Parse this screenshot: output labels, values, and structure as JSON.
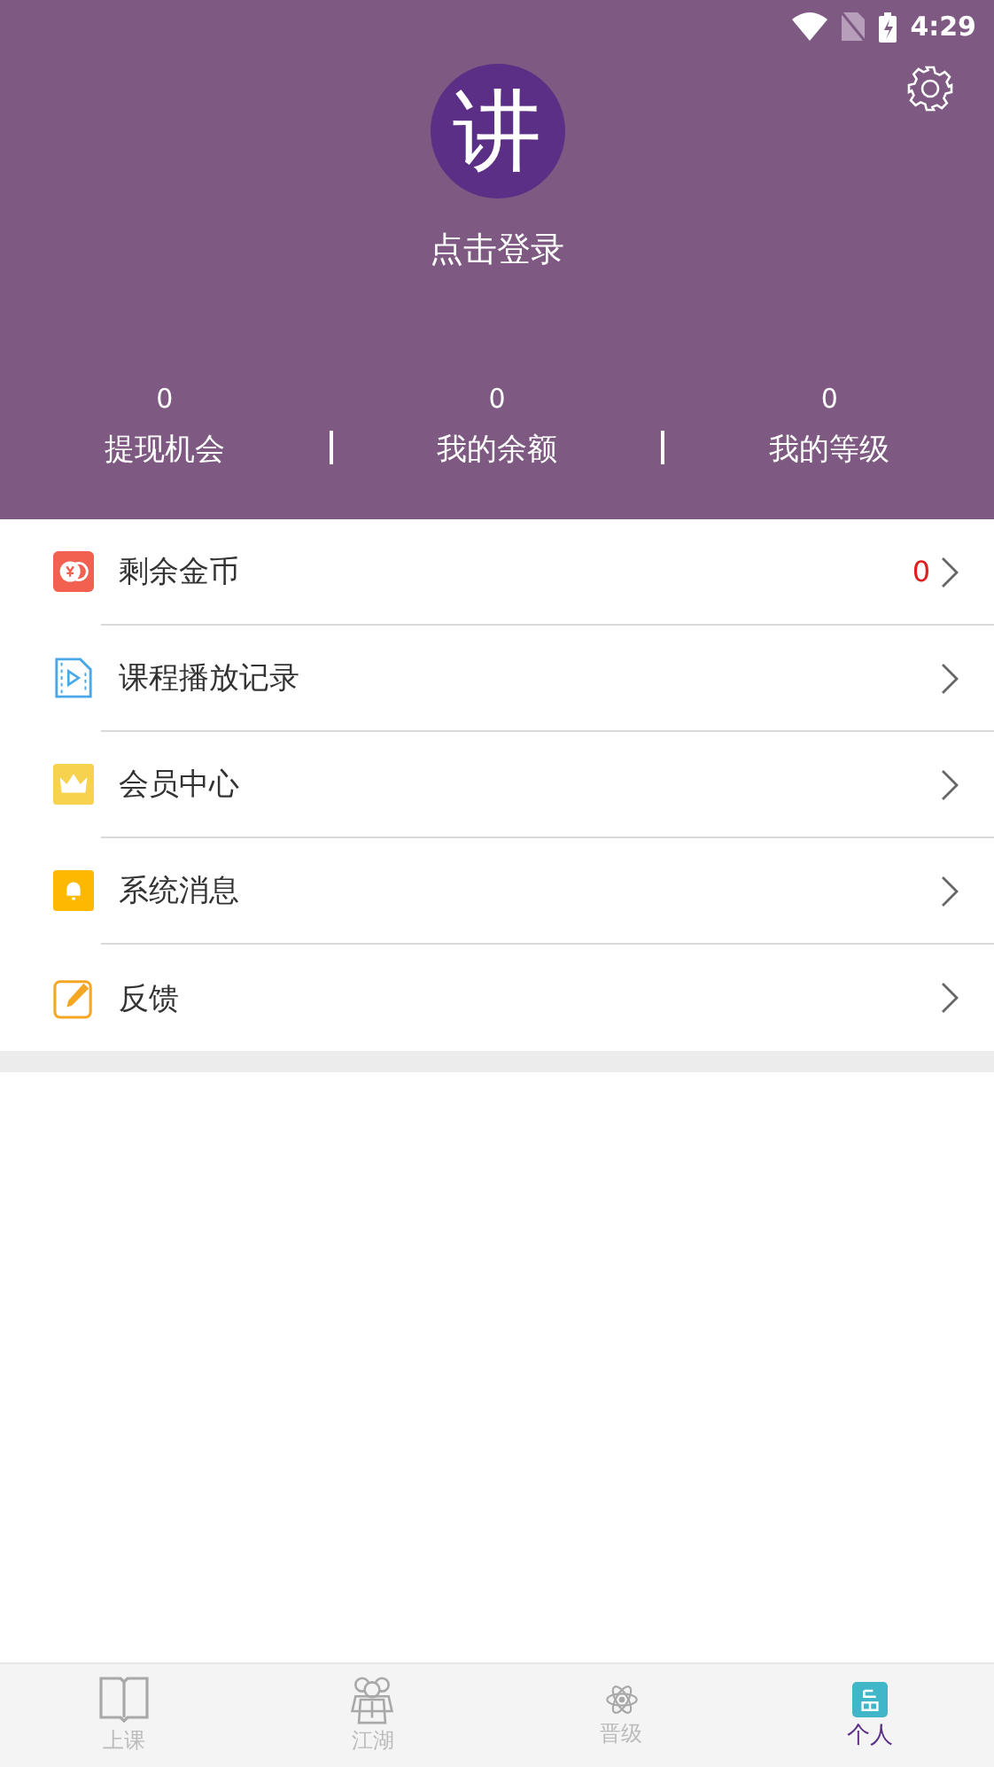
{
  "status_bar": {
    "time": "4:29"
  },
  "profile": {
    "avatar_text": "讲",
    "login_label": "点击登录"
  },
  "stats": [
    {
      "value": "0",
      "label": "提现机会"
    },
    {
      "value": "0",
      "label": "我的余额"
    },
    {
      "value": "0",
      "label": "我的等级"
    }
  ],
  "menu": [
    {
      "kind": "coin",
      "label": "剩余金币",
      "value": "0"
    },
    {
      "kind": "video",
      "label": "课程播放记录"
    },
    {
      "kind": "crown",
      "label": "会员中心"
    },
    {
      "kind": "bell",
      "label": "系统消息"
    },
    {
      "kind": "edit",
      "label": "反馈"
    }
  ],
  "tabs": [
    {
      "kind": "book",
      "label": "上课",
      "selected": false
    },
    {
      "kind": "people",
      "label": "江湖",
      "selected": false
    },
    {
      "kind": "atom",
      "label": "晋级",
      "selected": false
    },
    {
      "kind": "person",
      "label": "个人",
      "selected": true
    }
  ]
}
